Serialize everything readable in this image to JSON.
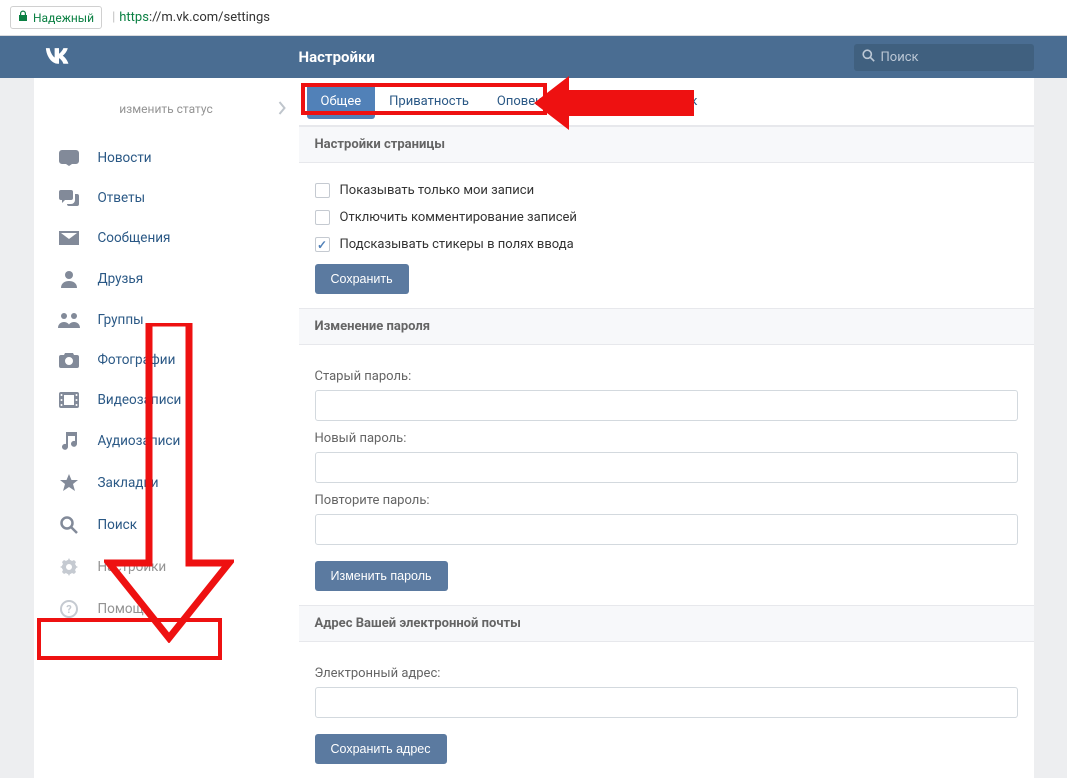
{
  "browser": {
    "secure_label": "Надежный",
    "url_https": "https",
    "url_rest": "://m.vk.com/settings"
  },
  "header": {
    "title": "Настройки",
    "search_placeholder": "Поиск"
  },
  "sidebar": {
    "status_text": "изменить статус",
    "items": [
      {
        "label": "Новости"
      },
      {
        "label": "Ответы"
      },
      {
        "label": "Сообщения"
      },
      {
        "label": "Друзья"
      },
      {
        "label": "Группы"
      },
      {
        "label": "Фотографии"
      },
      {
        "label": "Видеозаписи"
      },
      {
        "label": "Аудиозаписи"
      },
      {
        "label": "Закладки"
      },
      {
        "label": "Поиск"
      },
      {
        "label": "Настройки"
      },
      {
        "label": "Помощь"
      }
    ]
  },
  "tabs": {
    "items": [
      {
        "label": "Общее"
      },
      {
        "label": "Приватность"
      },
      {
        "label": "Оповещения"
      },
      {
        "label": "Чёрный список"
      }
    ]
  },
  "sections": {
    "page_settings": {
      "title": "Настройки страницы",
      "opt_only_mine": "Показывать только мои записи",
      "opt_disable_comments": "Отключить комментирование записей",
      "opt_suggest_stickers": "Подсказывать стикеры в полях ввода",
      "save_btn": "Сохранить"
    },
    "password": {
      "title": "Изменение пароля",
      "old_pw": "Старый пароль:",
      "new_pw": "Новый пароль:",
      "repeat_pw": "Повторите пароль:",
      "change_btn": "Изменить пароль"
    },
    "email": {
      "title": "Адрес Вашей электронной почты",
      "label": "Электронный адрес:",
      "save_btn": "Сохранить адрес"
    }
  }
}
